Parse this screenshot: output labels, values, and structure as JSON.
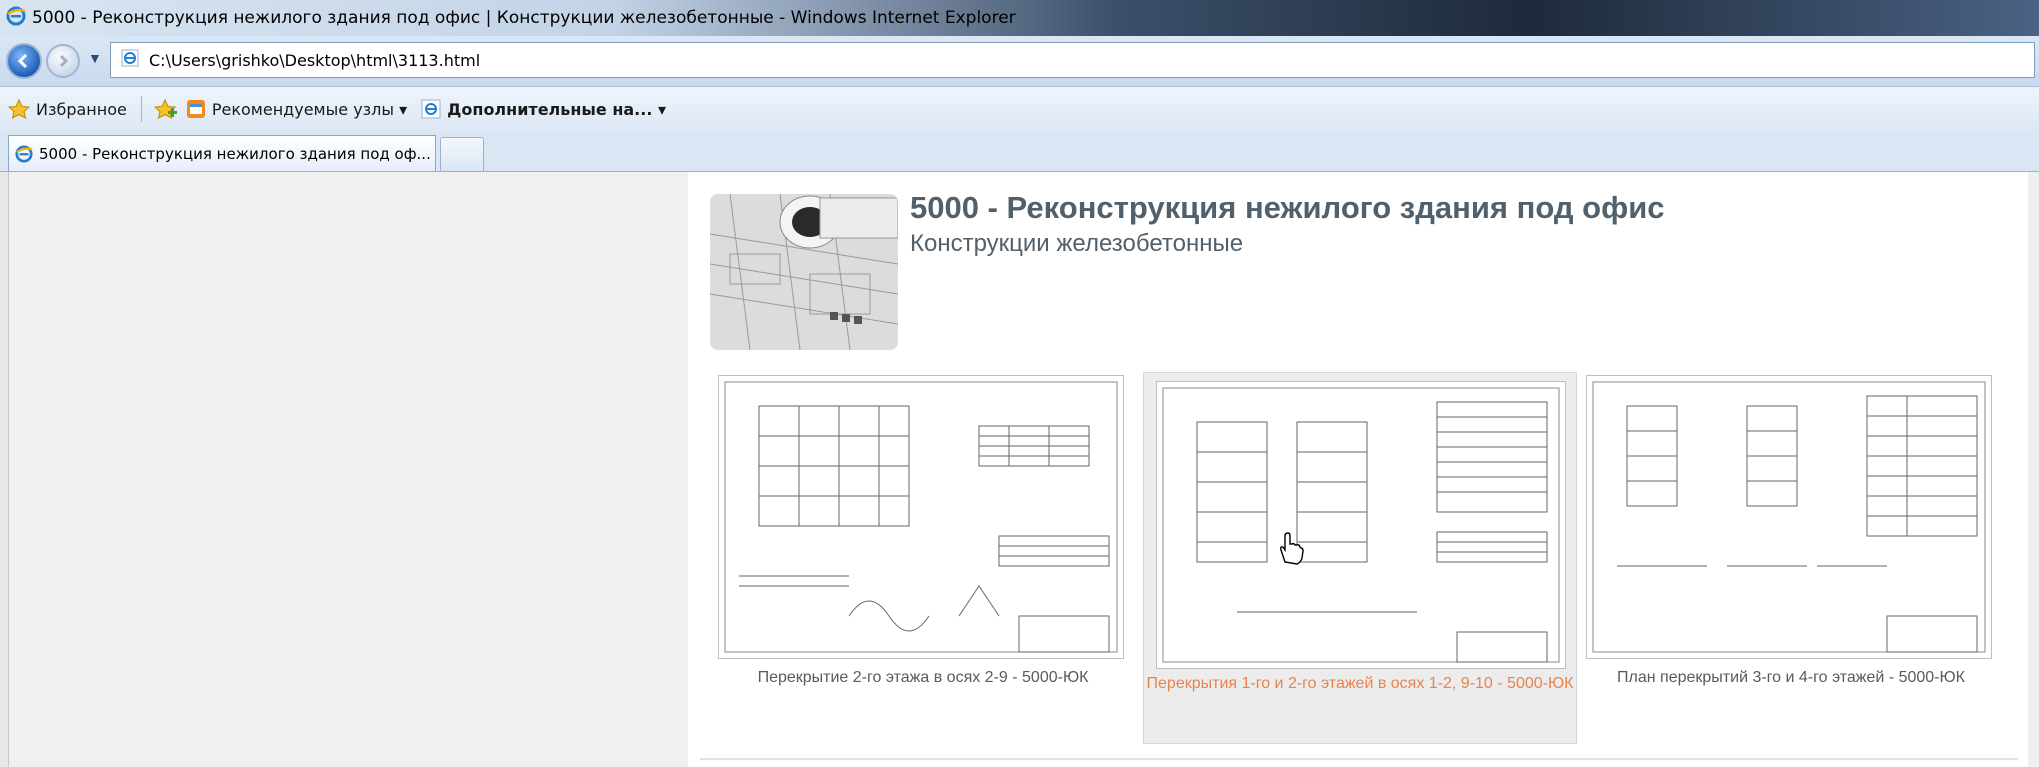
{
  "window": {
    "title": "5000 - Реконструкция нежилого здания под офис | Конструкции железобетонные - Windows Internet Explorer"
  },
  "address_bar": {
    "url": "C:\\Users\\grishko\\Desktop\\html\\3113.html"
  },
  "favorites_bar": {
    "favorites_label": "Избранное",
    "suggested_sites_label": "Рекомендуемые узлы ▾",
    "addons_label": "Дополнительные на... ▾"
  },
  "tabs": [
    {
      "label": "5000 - Реконструкция нежилого здания под оф..."
    }
  ],
  "page": {
    "title": "5000 - Реконструкция нежилого здания под офис",
    "subtitle": "Конструкции железобетонные",
    "cards": [
      {
        "caption": "Перекрытие 2-го этажа в осях 2-9 - 5000-ЮК"
      },
      {
        "caption": "Перекрытия 1-го и 2-го этажей в осях 1-2, 9-10 - 5000-ЮК"
      },
      {
        "caption": "План перекрытий 3-го и 4-го этажей - 5000-ЮК"
      }
    ]
  },
  "colors": {
    "heading": "#50606c",
    "caption": "#5a5a5a",
    "caption_hover": "#e9834b"
  }
}
